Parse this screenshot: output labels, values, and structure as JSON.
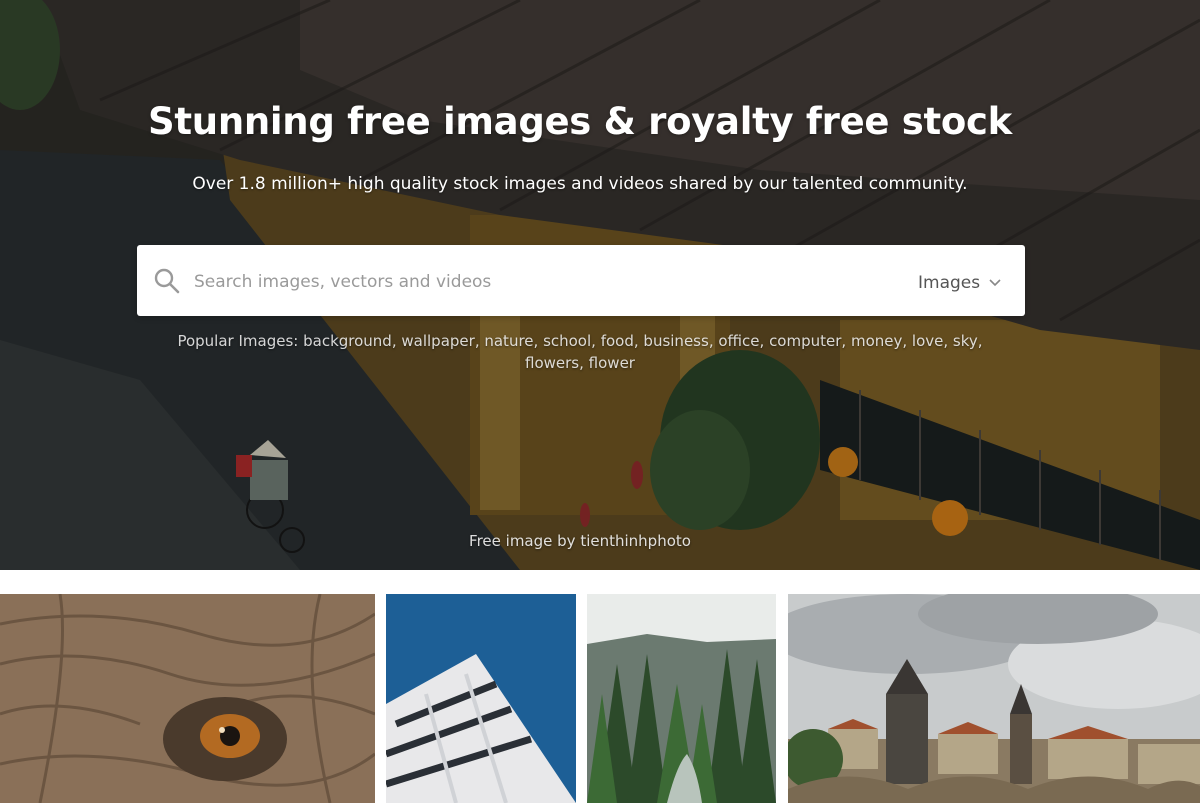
{
  "hero": {
    "title": "Stunning free images & royalty free stock",
    "subtitle": "Over 1.8 million+ high quality stock images and videos shared by our talented community.",
    "credit_prefix": "Free image by ",
    "credit_author": "tienthinhphoto"
  },
  "search": {
    "placeholder": "Search images, vectors and videos",
    "value": "",
    "type_selected": "Images",
    "icon": "search-icon"
  },
  "popular": {
    "label": "Popular Images:",
    "tags": [
      "background",
      "wallpaper",
      "nature",
      "school",
      "food",
      "business",
      "office",
      "computer",
      "money",
      "love",
      "sky",
      "flowers",
      "flower"
    ]
  },
  "gallery": {
    "items": [
      {
        "subject": "elephant eye close-up"
      },
      {
        "subject": "modern building facade"
      },
      {
        "subject": "forest and river"
      },
      {
        "subject": "old town with towers and bridge"
      }
    ]
  }
}
